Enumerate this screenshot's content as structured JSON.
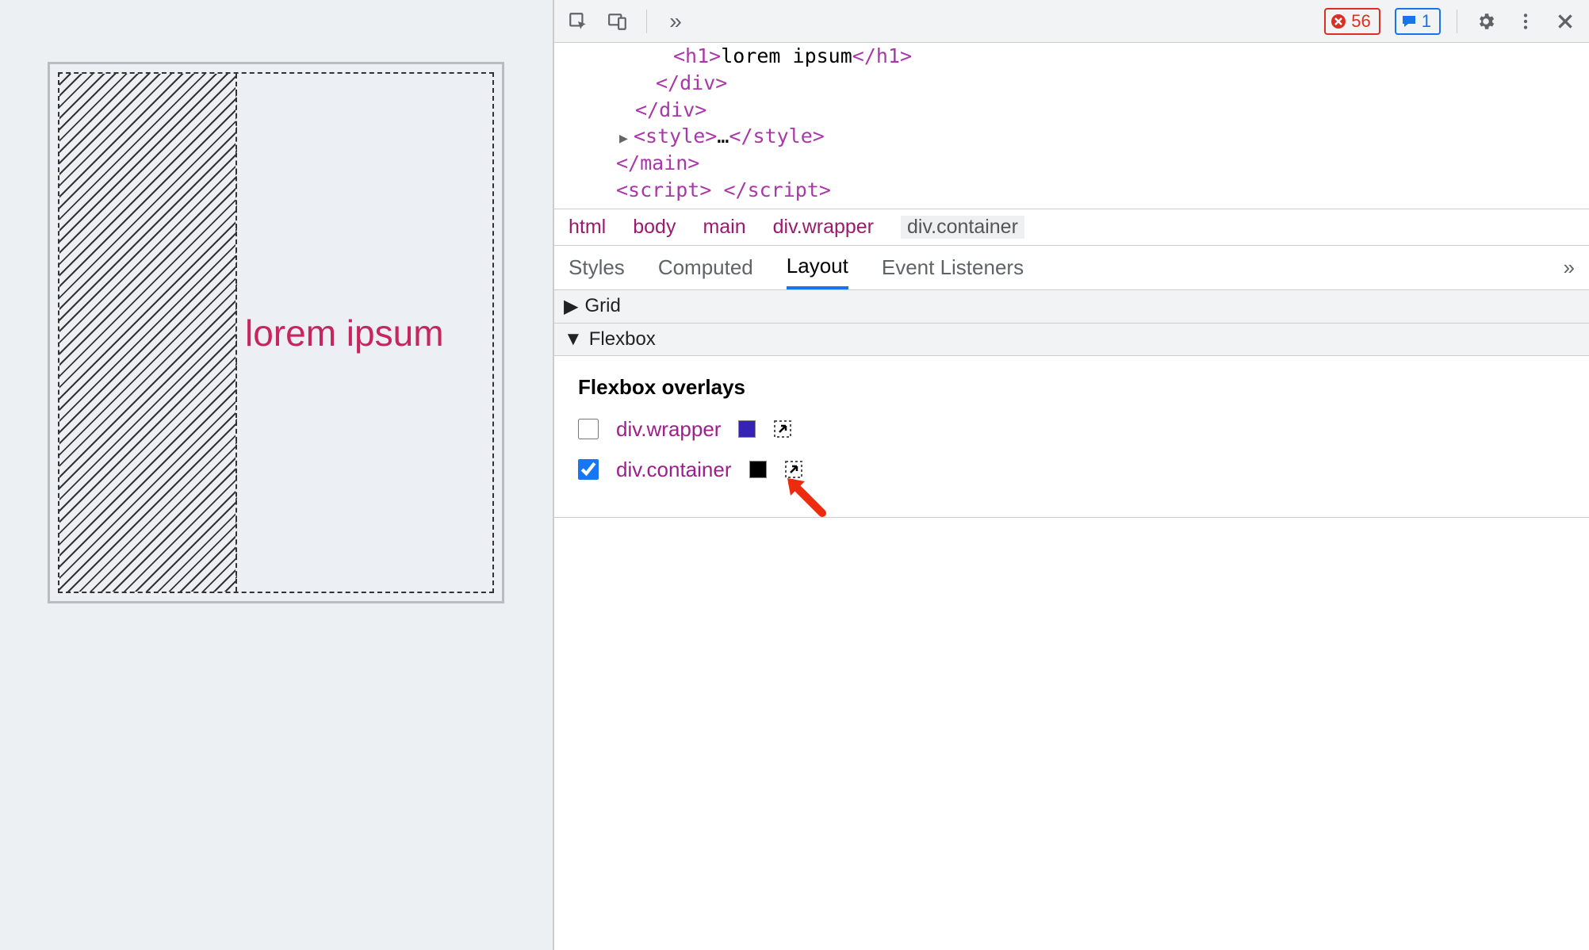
{
  "viewport": {
    "heading": "lorem ipsum"
  },
  "toolbar": {
    "errors": "56",
    "messages": "1"
  },
  "source": {
    "lines": {
      "h1_open": "<h1>",
      "h1_text": "lorem ipsum",
      "h1_close": "</h1>",
      "div_close1": "</div>",
      "div_close2": "</div>",
      "style": "<style>",
      "ellipsis": "…",
      "style_close": "</style>",
      "main_close": "</main>",
      "script": "<script> </scr",
      "script_rest": "ipt>"
    }
  },
  "breadcrumbs": [
    "html",
    "body",
    "main",
    "div.wrapper",
    "div.container"
  ],
  "tabs": {
    "styles": "Styles",
    "computed": "Computed",
    "layout": "Layout",
    "listeners": "Event Listeners"
  },
  "sections": {
    "grid": "Grid",
    "flexbox": "Flexbox"
  },
  "overlays": {
    "title": "Flexbox overlays",
    "items": [
      {
        "name": "div.wrapper",
        "checked": false
      },
      {
        "name": "div.container",
        "checked": true
      }
    ]
  }
}
